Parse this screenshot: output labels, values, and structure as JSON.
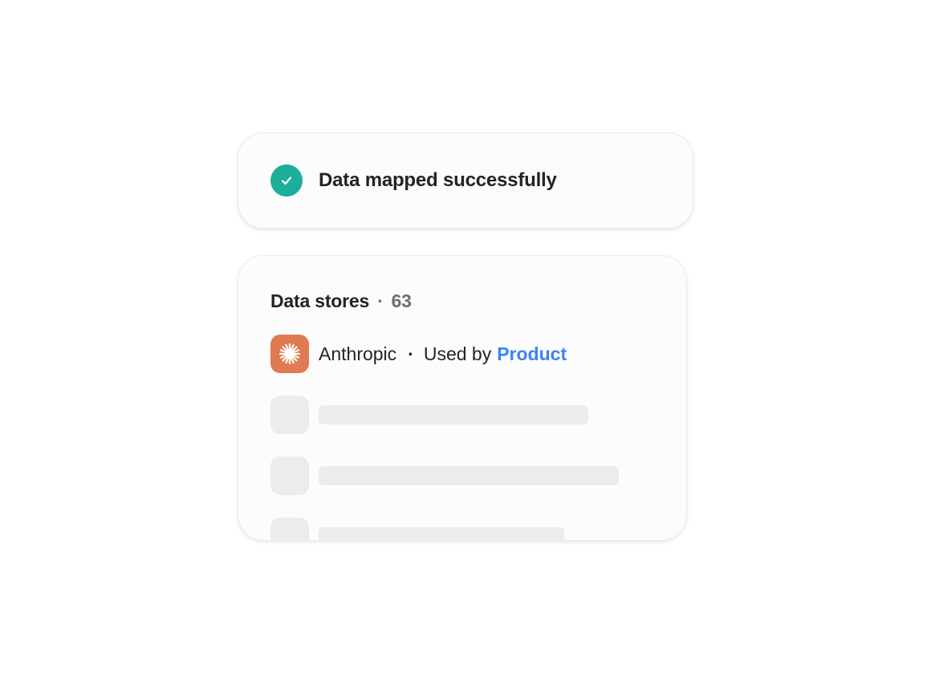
{
  "toast": {
    "icon": "check-circle-icon",
    "status_color": "#1dad9b",
    "message": "Data mapped successfully"
  },
  "data_stores": {
    "title": "Data stores",
    "separator": "·",
    "count": "63",
    "items": [
      {
        "icon": "anthropic-logo-icon",
        "icon_color": "#e07a52",
        "name": "Anthropic",
        "separator": "·",
        "used_by_label": "Used by",
        "team": "Product",
        "team_color": "#3b82f6"
      }
    ],
    "loading_placeholders": 3
  }
}
